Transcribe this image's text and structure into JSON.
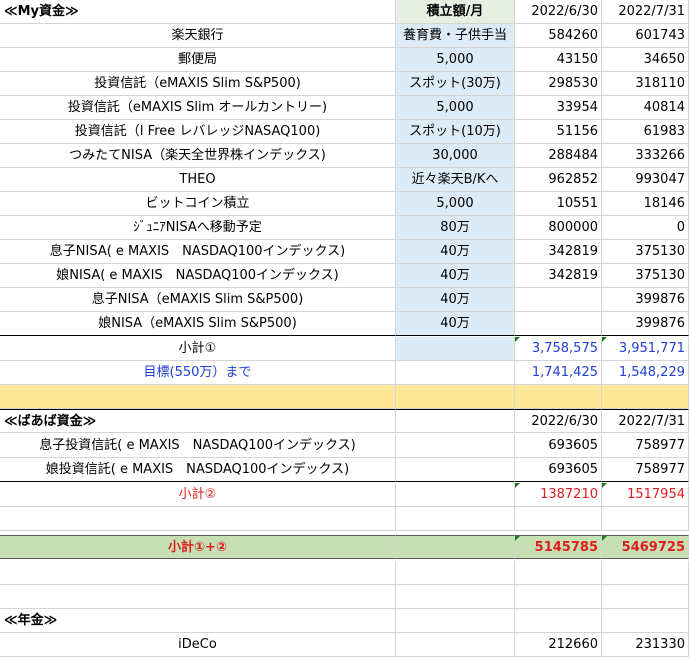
{
  "header": {
    "title": "≪My資金≫",
    "col_monthly": "積立額/月",
    "date1": "2022/6/30",
    "date2": "2022/7/31"
  },
  "my_funds": [
    {
      "name": "楽天銀行",
      "monthly": "養育費・子供手当",
      "v1": "584260",
      "v2": "601743"
    },
    {
      "name": "郵便局",
      "monthly": "5,000",
      "v1": "43150",
      "v2": "34650"
    },
    {
      "name": "投資信託（eMAXIS Slim S&P500)",
      "monthly": "スポット(30万)",
      "v1": "298530",
      "v2": "318110"
    },
    {
      "name": "投資信託（eMAXIS Slim オールカントリー)",
      "monthly": "5,000",
      "v1": "33954",
      "v2": "40814"
    },
    {
      "name": "投資信託（I Free レバレッジNASAQ100)",
      "monthly": "スポット(10万)",
      "v1": "51156",
      "v2": "61983"
    },
    {
      "name": "つみたてNISA（楽天全世界株インデックス)",
      "monthly": "30,000",
      "v1": "288484",
      "v2": "333266"
    },
    {
      "name": "THEO",
      "monthly": "近々楽天B/Kへ",
      "v1": "962852",
      "v2": "993047"
    },
    {
      "name": "ビットコイン積立",
      "monthly": "5,000",
      "v1": "10551",
      "v2": "18146"
    },
    {
      "name": "ｼﾞｭﾆｱNISAへ移動予定",
      "monthly": "80万",
      "v1": "800000",
      "v2": "0"
    },
    {
      "name": "息子NISA( e MAXIS　NASDAQ100インデックス)",
      "monthly": "40万",
      "v1": "342819",
      "v2": "375130"
    },
    {
      "name": "娘NISA( e MAXIS　NASDAQ100インデックス)",
      "monthly": "40万",
      "v1": "342819",
      "v2": "375130"
    },
    {
      "name": "息子NISA（eMAXIS Slim S&P500)",
      "monthly": "40万",
      "v1": "",
      "v2": "399876"
    },
    {
      "name": "娘NISA（eMAXIS Slim S&P500)",
      "monthly": "40万",
      "v1": "",
      "v2": "399876"
    }
  ],
  "subtotal1": {
    "label": "小計①",
    "v1": "3,758,575",
    "v2": "3,951,771"
  },
  "target": {
    "label": "目標(550万）まで",
    "v1": "1,741,425",
    "v2": "1,548,229"
  },
  "grandma": {
    "title": "≪ばあば資金≫",
    "date1": "2022/6/30",
    "date2": "2022/7/31",
    "rows": [
      {
        "name": "息子投資信託( e MAXIS　NASDAQ100インデックス)",
        "v1": "693605",
        "v2": "758977"
      },
      {
        "name": "娘投資信託( e MAXIS　NASDAQ100インデックス)",
        "v1": "693605",
        "v2": "758977"
      }
    ],
    "subtotal2": {
      "label": "小計②",
      "v1": "1387210",
      "v2": "1517954"
    }
  },
  "total": {
    "label": "小計①+②",
    "v1": "5145785",
    "v2": "5469725"
  },
  "pension": {
    "title": "≪年金≫",
    "ideco": {
      "name": "iDeCo",
      "v1": "212660",
      "v2": "231330"
    }
  },
  "colors": {
    "blue_cell": "#ddebf7",
    "yellow_band": "#ffe699",
    "green_total": "#c6e0b4",
    "red_text": "#e21d1d",
    "blue_text": "#1f3fd6"
  }
}
